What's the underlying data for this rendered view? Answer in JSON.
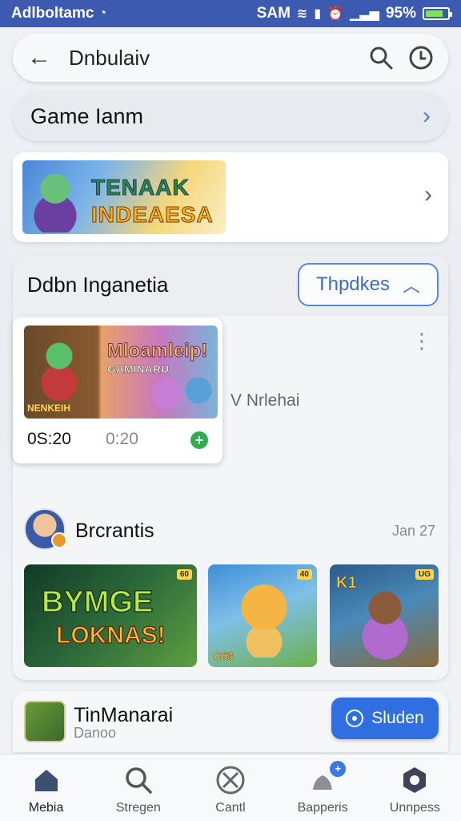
{
  "status_bar": {
    "app_name": "Adlboltamc",
    "carrier": "SAM",
    "battery_pct": "95%",
    "accent": "#3c5bb0"
  },
  "search": {
    "back_icon": "arrow-left-icon",
    "text": "Dnbulaiv"
  },
  "game_row": {
    "label": "Game Ianm"
  },
  "banner": {
    "line1": "TENAAK",
    "line2": "INDEAESA"
  },
  "section": {
    "title": "Ddbn Inganetia",
    "toggle_label": "Thpdkes",
    "video": {
      "title": "Mloamleip!",
      "subtitle": "GAMINARU",
      "caption": "NENKEIH",
      "time_current": "0S:20",
      "time_total": "0:20"
    },
    "side_label": "V Nrlehai",
    "author": {
      "name": "Brcrantis",
      "date": "Jan 27"
    },
    "thumbnails": [
      {
        "line1": "BYMGE",
        "line2": "LOKNAS!",
        "tag": "60"
      },
      {
        "caption": "C63",
        "tag": "40"
      },
      {
        "caption": "K1",
        "tag": "UG"
      }
    ]
  },
  "notice": {
    "title": "TinManarai",
    "subtitle": "Danoo",
    "button_label": "Sluden",
    "button_color": "#2f6fe0"
  },
  "bottom_nav": {
    "items": [
      {
        "label": "Mebia",
        "icon": "home-icon"
      },
      {
        "label": "Stregen",
        "icon": "search-icon"
      },
      {
        "label": "Cantl",
        "icon": "compass-icon"
      },
      {
        "label": "Bapperis",
        "icon": "notifications-icon",
        "badge": "+"
      },
      {
        "label": "Unnpess",
        "icon": "gear-icon"
      }
    ]
  }
}
